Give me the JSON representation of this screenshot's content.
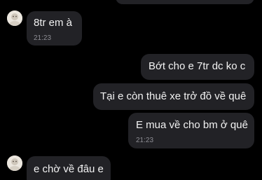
{
  "messages": [
    {
      "direction": "incoming",
      "text": "8tr em à",
      "time": "21:23"
    },
    {
      "direction": "outgoing",
      "text": "Bớt cho e 7tr dc ko c"
    },
    {
      "direction": "outgoing",
      "text": "Tại e còn thuê xe trở đồ về quê"
    },
    {
      "direction": "outgoing",
      "text": "E mua về cho bm ở quê",
      "time": "21:23"
    },
    {
      "direction": "incoming",
      "text": "e chờ về đâu e"
    }
  ],
  "colors": {
    "background": "#000000",
    "bubble": "#222226",
    "text": "#f2f2f2",
    "timestamp": "#8d8d93"
  },
  "icons": {
    "avatar": "contact-avatar-icon"
  }
}
